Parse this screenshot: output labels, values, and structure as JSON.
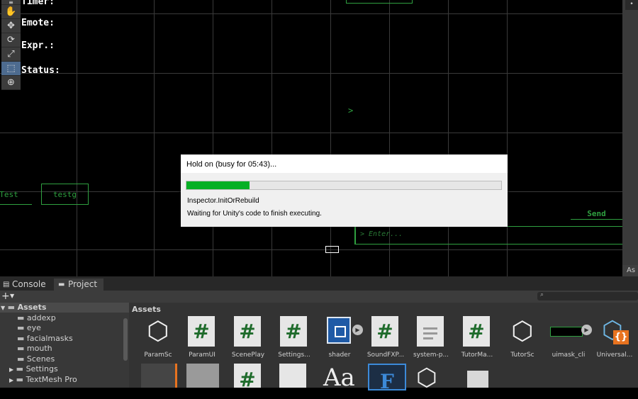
{
  "scene": {
    "hud_lines": [
      "Timer:",
      "Emote:",
      "Expr.:",
      "Status:"
    ],
    "button_test": "Test",
    "button_testg": "testg",
    "send_label": "Send",
    "input_placeholder": "> Enter...",
    "arrow": ">"
  },
  "dialog": {
    "title": "Hold on (busy for 05:43)...",
    "progress_percent": 20,
    "task": "Inspector.InitOrRebuild",
    "message": "Waiting for Unity's code to finish executing."
  },
  "panel": {
    "tabs": [
      "Console",
      "Project"
    ],
    "add_label": "+",
    "assets_header": "Assets",
    "tree": [
      "Assets",
      "addexp",
      "eye",
      "facialmasks",
      "mouth",
      "Scenes",
      "Settings",
      "TextMesh Pro"
    ],
    "right_label": "As",
    "assets": [
      {
        "label": "ParamSc",
        "icon": "unity-cube-icon"
      },
      {
        "label": "ParamUI",
        "icon": "csharp-script-icon"
      },
      {
        "label": "ScenePlay",
        "icon": "csharp-script-icon"
      },
      {
        "label": "Settings...",
        "icon": "csharp-script-icon"
      },
      {
        "label": "shader",
        "icon": "shader-icon"
      },
      {
        "label": "SoundFXP...",
        "icon": "csharp-script-icon"
      },
      {
        "label": "system-p...",
        "icon": "text-file-icon"
      },
      {
        "label": "TutorMa...",
        "icon": "csharp-script-icon"
      },
      {
        "label": "TutorSc",
        "icon": "unity-cube-icon"
      },
      {
        "label": "uimask_cli",
        "icon": "mask-icon"
      },
      {
        "label": "Universal...",
        "icon": "json-cube-icon"
      }
    ]
  }
}
